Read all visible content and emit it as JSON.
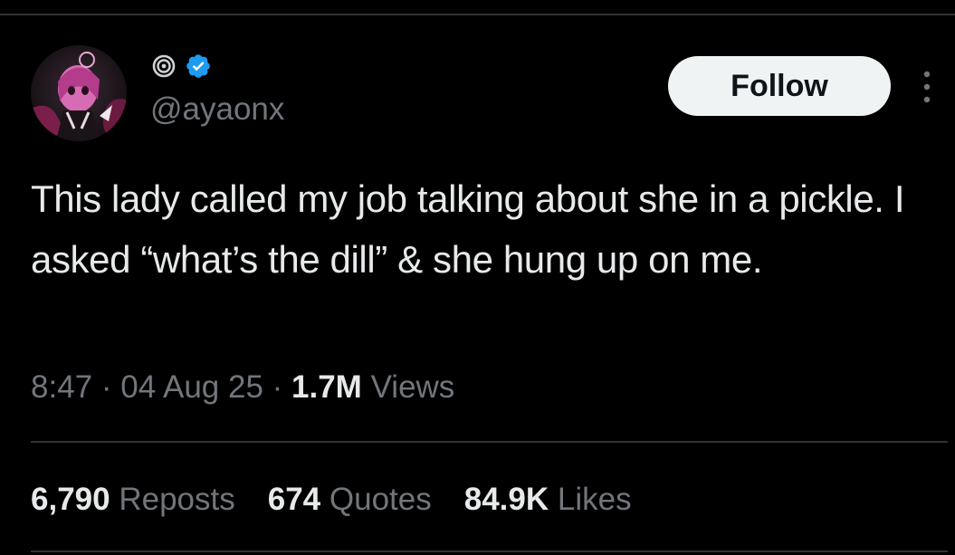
{
  "user": {
    "handle": "@ayaonx",
    "name_icon": "spiral-emoji-icon",
    "verified_icon": "verified-badge-icon"
  },
  "actions": {
    "follow_label": "Follow",
    "more_icon": "more-vertical-icon"
  },
  "tweet": {
    "text": "This lady called my job talking about she in a pickle. I asked “what’s the dill” & she hung up on me.",
    "time": "8:47",
    "date": "04 Aug 25",
    "views_count": "1.7M",
    "views_label": "Views",
    "separator": "·"
  },
  "stats": {
    "reposts_count": "6,790",
    "reposts_label": "Reposts",
    "quotes_count": "674",
    "quotes_label": "Quotes",
    "likes_count": "84.9K",
    "likes_label": "Likes"
  },
  "colors": {
    "background": "#000000",
    "text_primary": "#e7e9ea",
    "text_secondary": "#71767b",
    "divider": "#2f3336",
    "verified_blue": "#1d9bf0",
    "follow_bg": "#eff3f4"
  }
}
